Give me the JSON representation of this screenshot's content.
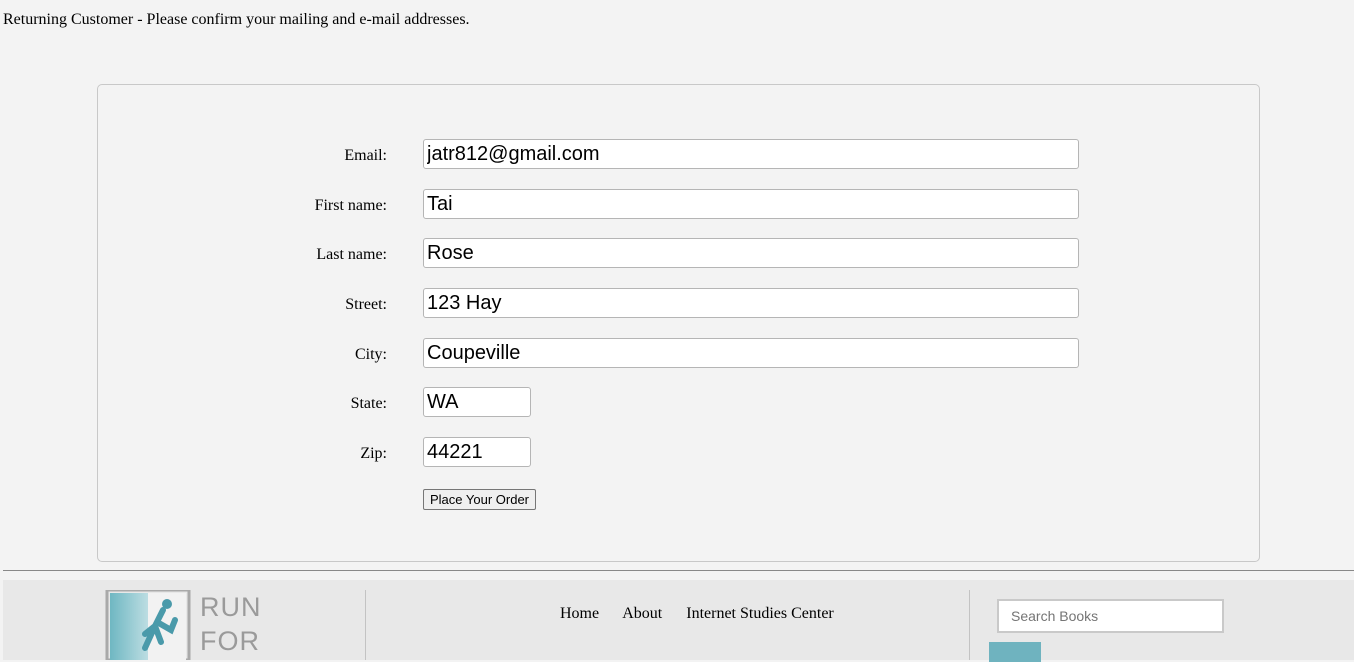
{
  "intro_text": "Returning Customer - Please confirm your mailing and e-mail addresses.",
  "form": {
    "email_label": "Email:",
    "email_value": "jatr812@gmail.com",
    "first_name_label": "First name:",
    "first_name_value": "Tai",
    "last_name_label": "Last name:",
    "last_name_value": "Rose",
    "street_label": "Street:",
    "street_value": "123 Hay",
    "city_label": "City:",
    "city_value": "Coupeville",
    "state_label": "State:",
    "state_value": "WA",
    "zip_label": "Zip:",
    "zip_value": "44221",
    "submit_label": "Place Your Order"
  },
  "footer": {
    "logo_line1": "RUN",
    "logo_line2": "FOR",
    "nav": [
      "Home",
      "About",
      "Internet Studies Center"
    ],
    "search_placeholder": "Search Books"
  },
  "colors": {
    "background": "#f3f3f3",
    "footer_background": "#e8e8e8",
    "logo_accent": "#5fa8b5"
  }
}
